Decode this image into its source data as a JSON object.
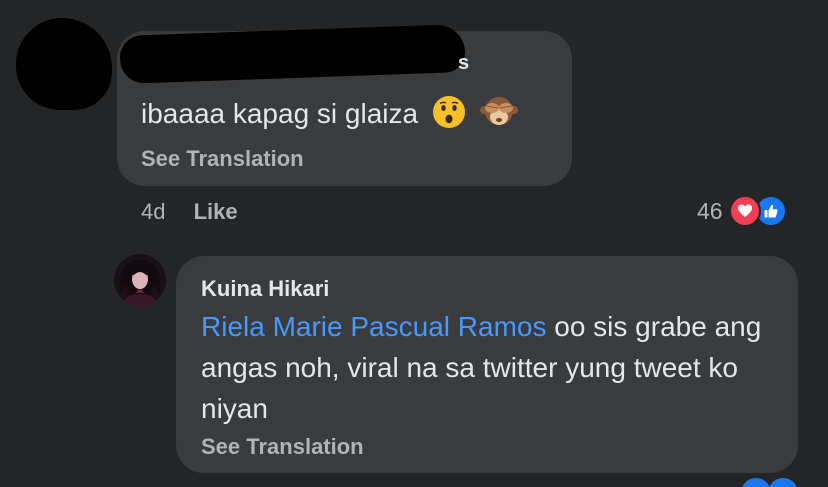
{
  "comment": {
    "author_tail": "s",
    "text": "ibaaaa kapag si glaiza",
    "emojis": [
      "surprised-face-emoji",
      "see-no-evil-monkey-emoji"
    ],
    "see_translation": "See Translation",
    "time": "4d",
    "like_label": "Like",
    "reaction_count": "46",
    "reactions": [
      "love-reaction-icon",
      "like-reaction-icon"
    ]
  },
  "reply": {
    "author": "Kuina Hikari",
    "mention": "Riela Marie Pascual Ramos",
    "text": " oo sis grabe ang angas noh, viral na sa twitter yung tweet ko niyan",
    "see_translation": "See Translation"
  },
  "colors": {
    "background": "#242526",
    "bubble": "#3a3b3c",
    "primary_text": "#e4e6eb",
    "secondary_text": "#b0b3b8",
    "mention": "#4599ff",
    "love": "#f33e58",
    "like": "#1877f2"
  }
}
